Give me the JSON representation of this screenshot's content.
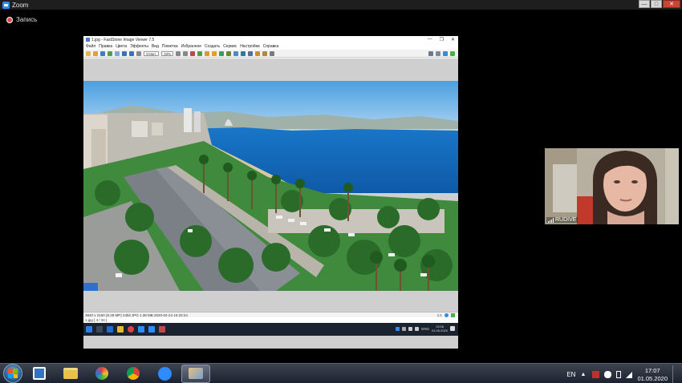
{
  "zoom": {
    "title": "Zoom",
    "controls": {
      "minimize": "—",
      "maximize": "□",
      "close": "✕"
    },
    "recording_label": "Запись"
  },
  "fastone": {
    "window_title": "1.jpg - FastStone Image Viewer 7.5",
    "title_controls": {
      "minimize": "—",
      "maximize": "❐",
      "close": "✕"
    },
    "menu": [
      "Файл",
      "Правка",
      "Цвета",
      "Эффекты",
      "Вид",
      "Пометка",
      "Избранное",
      "Создать",
      "Сервис",
      "Настройки",
      "Справка"
    ],
    "toolbar": {
      "fit_label": "Ответ.",
      "zoom_value": "33%"
    },
    "status_info": "3840 x 2160 (8.29 MP)  24bit  JPG   1.38 MB   2020-04-24 16:33:24",
    "status_zoom": "1:1",
    "status_file": "1.jpg [ 4 / 34 ]"
  },
  "inner_taskbar": {
    "lang": "ENG",
    "time": "13:06",
    "date": "01.05.2020"
  },
  "participant": {
    "name": "RUDIVE"
  },
  "taskbar": {
    "lang": "EN",
    "time": "17:07",
    "date": "01.05.2020"
  },
  "icons": {
    "zoom_app": "zoom-logo-icon",
    "record": "record-icon",
    "start": "windows-start-icon",
    "video_player": "video-player-icon",
    "folder": "folder-icon",
    "paint": "paint-icon",
    "chrome": "chrome-icon",
    "zoom_taskbar": "zoom-icon",
    "fastone": "fastone-icon"
  },
  "colors": {
    "zoom_blue": "#2d8cff",
    "record_red": "#e04848",
    "sky": "#4a9fe0",
    "sea": "#1976c8"
  }
}
